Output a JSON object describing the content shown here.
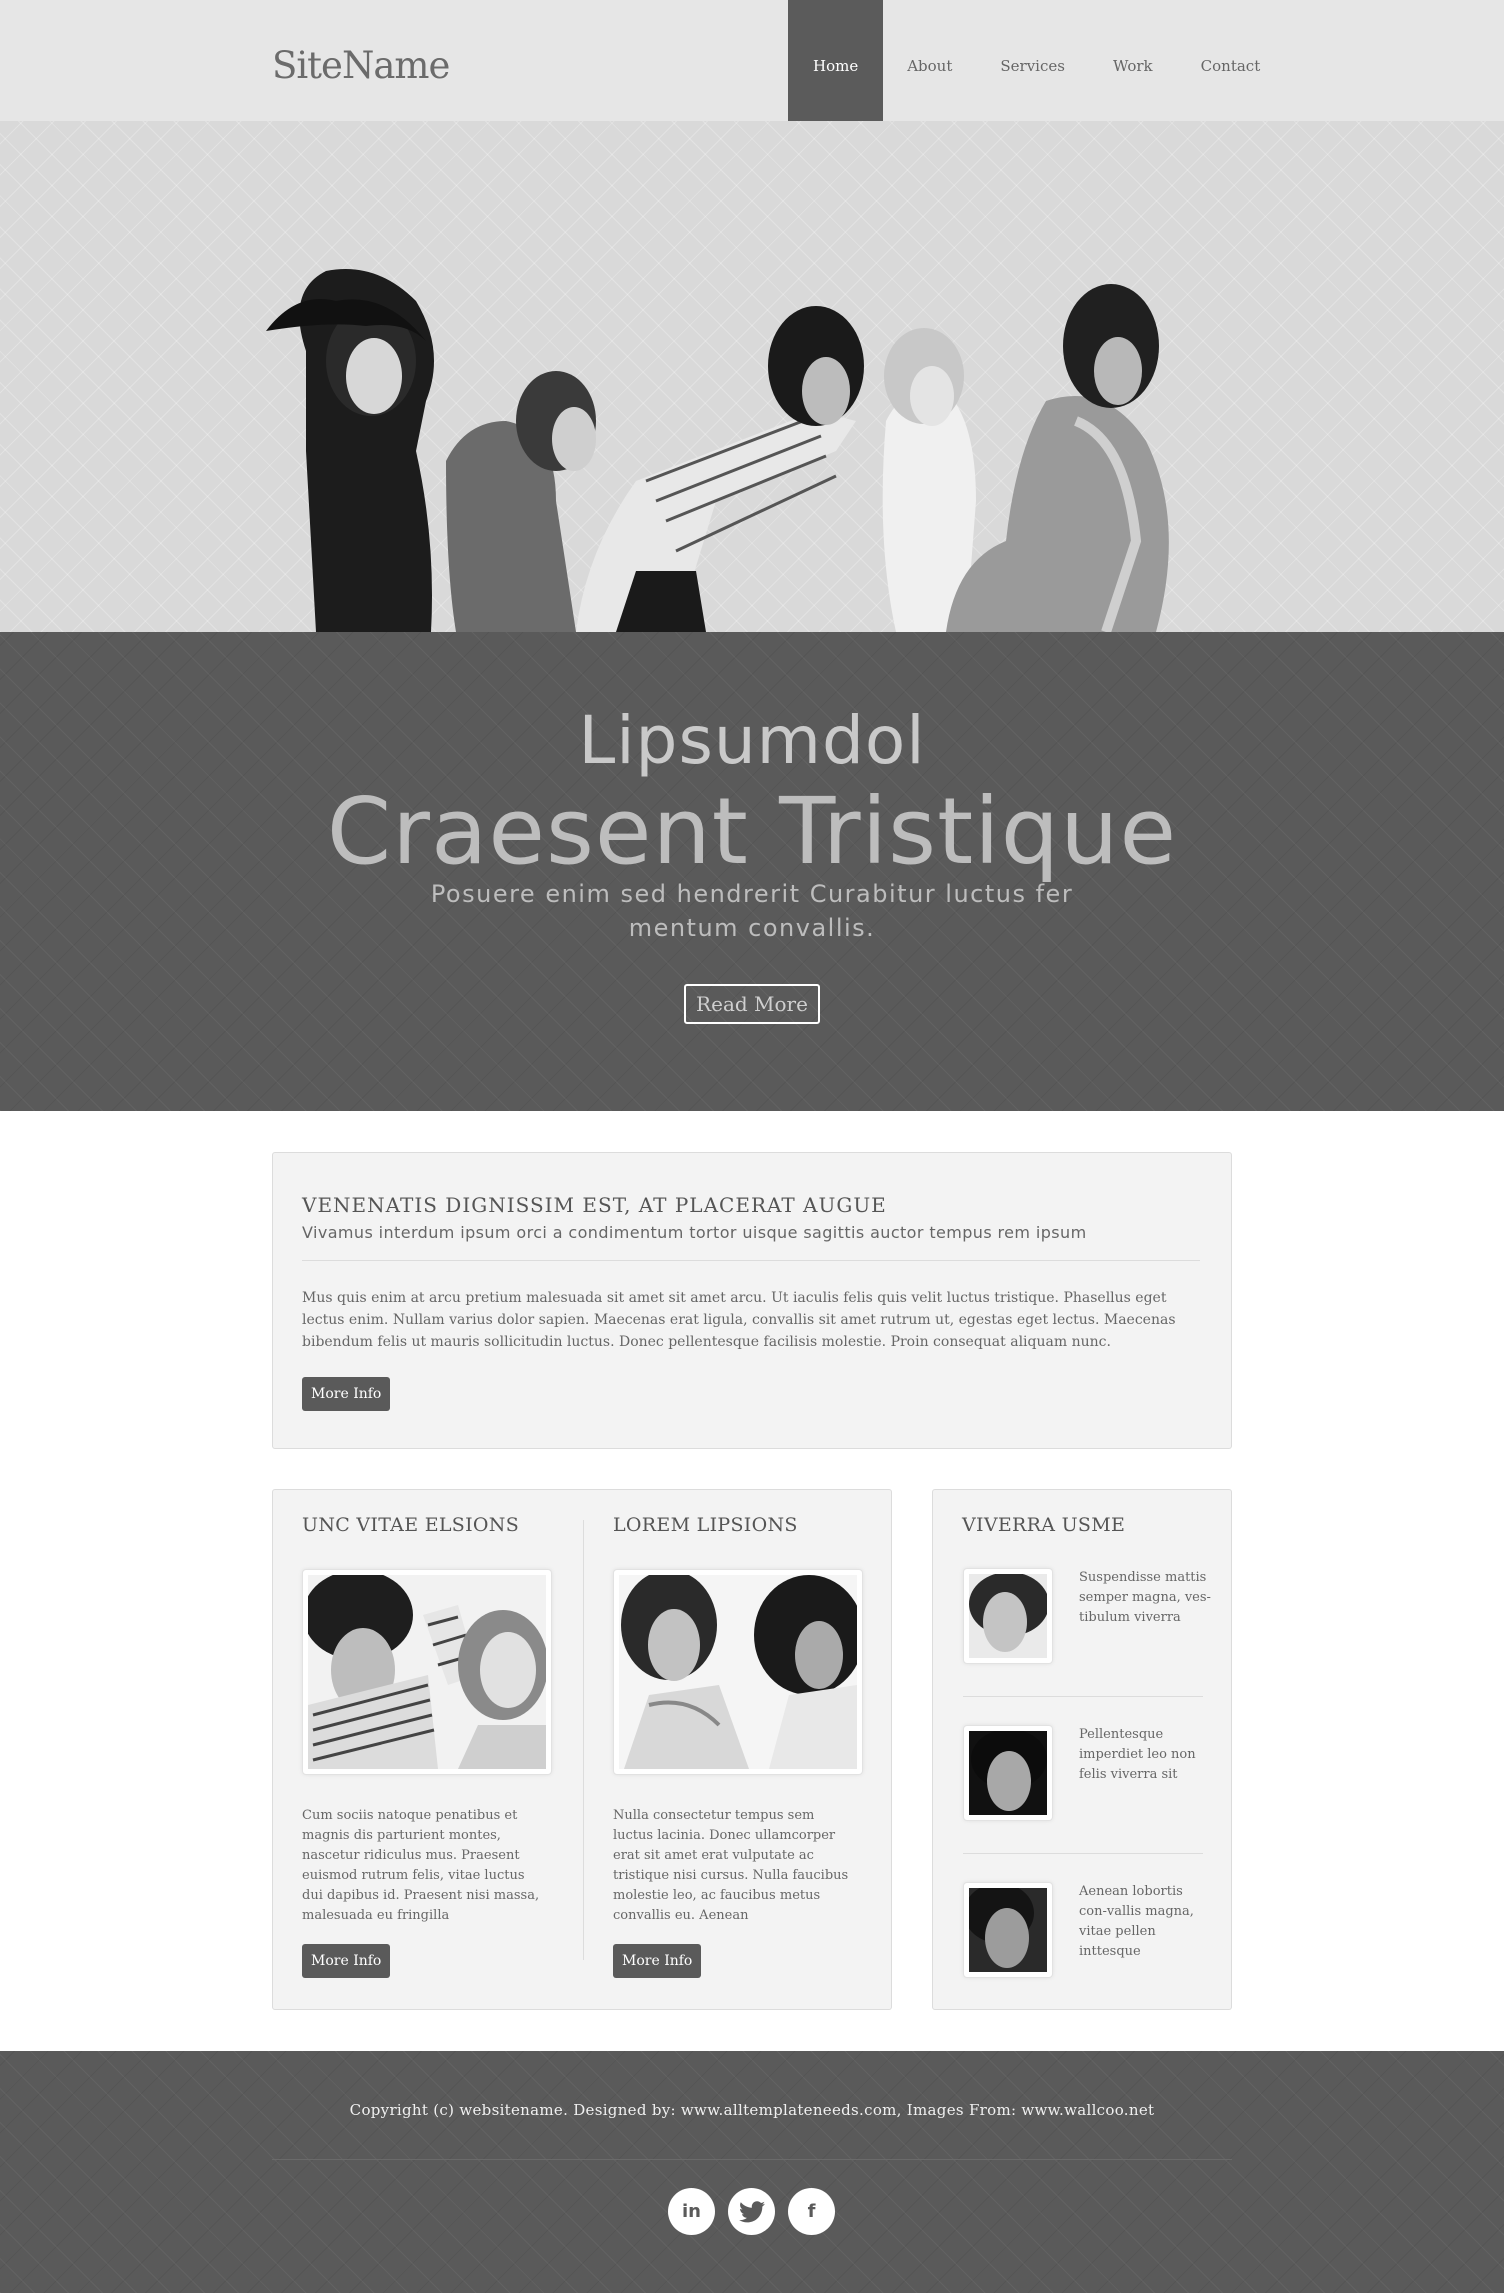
{
  "header": {
    "logo": "SiteName",
    "nav": [
      "Home",
      "About",
      "Services",
      "Work",
      "Contact"
    ]
  },
  "banner": {
    "subtitle": "Lipsumdol",
    "title": "Craesent Tristique",
    "text": "Posuere enim sed hendrerit Curabitur luctus fer mentum convallis.",
    "button": "Read More"
  },
  "intro": {
    "heading": "VENENATIS DIGNISSIM EST, AT PLACERAT AUGUE",
    "lead": "Vivamus interdum ipsum orci a condimentum tortor uisque sagittis auctor tempus rem ipsum",
    "body": "Mus quis enim at arcu pretium malesuada sit amet sit amet arcu. Ut iaculis felis quis velit luctus tristique. Phasellus eget lectus enim. Nullam varius dolor sapien. Maecenas erat ligula, convallis sit amet rutrum ut, egestas eget lectus. Maecenas bibendum felis ut mauris sollicitudin luctus. Donec pellentesque facilisis molestie. Proin consequat aliquam nunc.",
    "button": "More Info"
  },
  "columns": [
    {
      "title": "UNC VITAE ELSIONS",
      "text": "Cum sociis natoque penatibus et magnis dis parturient montes, nascetur ridiculus mus. Praesent euismod rutrum felis, vitae luctus dui dapibus id. Praesent nisi massa, malesuada eu fringilla",
      "button": "More Info"
    },
    {
      "title": "LOREM LIPSIONS",
      "text": "Nulla consectetur tempus sem luctus lacinia. Donec ullamcorper erat sit amet erat vulputate ac tristique nisi cursus. Nulla faucibus molestie leo, ac faucibus metus convallis eu. Aenean",
      "button": "More Info"
    }
  ],
  "sidebar": {
    "title": "VIVERRA USME",
    "items": [
      {
        "text": "Suspendisse mattis semper magna, ves-tibulum viverra"
      },
      {
        "text": "Pellentesque imperdiet leo non felis viverra sit"
      },
      {
        "text": "Aenean lobortis con-vallis magna, vitae pellen inttesque"
      }
    ]
  },
  "footer": {
    "copyright": "Copyright (c) websitename. Designed by: www.alltemplateneeds.com, Images From: www.wallcoo.net",
    "socials": [
      {
        "icon": "linkedin-icon",
        "glyph": "in"
      },
      {
        "icon": "twitter-icon",
        "glyph": "🐦"
      },
      {
        "icon": "facebook-icon",
        "glyph": "f"
      }
    ]
  },
  "colors": {
    "header_bg": "#e6e6e6",
    "accent_dark": "#5a5a5a",
    "box_bg": "#f3f3f3"
  }
}
